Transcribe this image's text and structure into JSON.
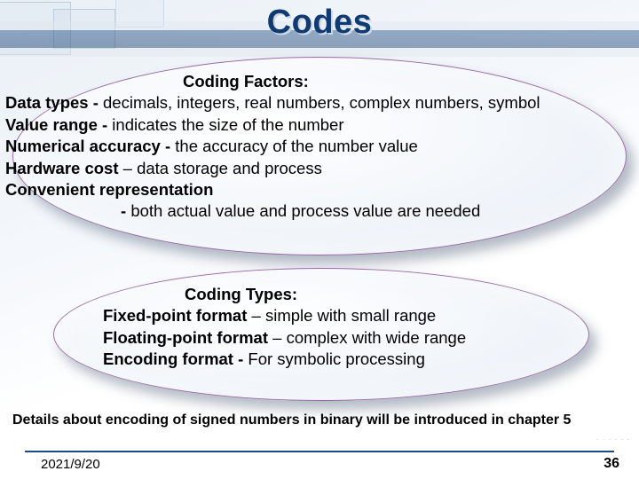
{
  "slide": {
    "title": "Codes",
    "factors": {
      "heading": "Coding Factors:",
      "lines": {
        "l0a": "Data types - ",
        "l0b": "decimals, integers, real numbers, complex numbers, symbol",
        "l1a": "Value range - ",
        "l1b": "indicates the size of the number",
        "l2a": "Numerical accuracy - ",
        "l2b": "the accuracy of the number value",
        "l3a": "Hardware cost",
        "l3b": " – data storage and process",
        "l4a": "Convenient representation",
        "l5a": "- ",
        "l5b": "both actual value and process value are needed"
      }
    },
    "types": {
      "heading": "Coding Types:",
      "lines": {
        "t0a": "Fixed-point format",
        "t0b": " – simple with small range",
        "t1a": "Floating-point format",
        "t1b": " – complex with wide range",
        "t2a": "Encoding format - ",
        "t2b": "For symbolic processing"
      }
    },
    "details": "Details about encoding of signed numbers in binary will be introduced in chapter 5",
    "footer": {
      "date": "2021/9/20",
      "page": "36"
    }
  }
}
